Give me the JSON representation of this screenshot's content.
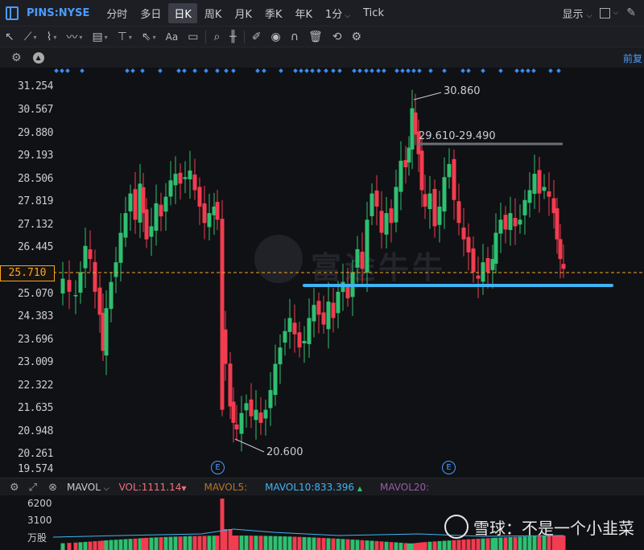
{
  "header": {
    "symbol": "PINS:NYSE",
    "timeframes": [
      {
        "label": "分时",
        "active": false,
        "dropdown": false
      },
      {
        "label": "多日",
        "active": false,
        "dropdown": false
      },
      {
        "label": "日K",
        "active": true,
        "dropdown": false
      },
      {
        "label": "周K",
        "active": false,
        "dropdown": false
      },
      {
        "label": "月K",
        "active": false,
        "dropdown": false
      },
      {
        "label": "季K",
        "active": false,
        "dropdown": false
      },
      {
        "label": "年K",
        "active": false,
        "dropdown": false
      },
      {
        "label": "1分",
        "active": false,
        "dropdown": true
      },
      {
        "label": "Tick",
        "active": false,
        "dropdown": false
      }
    ],
    "display_label": "显示"
  },
  "subbar": {
    "adjust_label": "前复"
  },
  "price_axis": {
    "labels": [
      "31.254",
      "30.567",
      "29.880",
      "29.193",
      "28.506",
      "27.819",
      "27.132",
      "26.445",
      "25.070",
      "24.383",
      "23.696",
      "23.009",
      "22.322",
      "21.635",
      "20.948",
      "20.261",
      "19.574"
    ],
    "current_price": "25.710"
  },
  "annotations": {
    "high": "30.860",
    "low": "20.600",
    "range": "29.610-29.490",
    "earnings_marker": "E"
  },
  "watermark": "富途牛牛",
  "volume_bar": {
    "indicator": "MAVOL",
    "vol": "VOL:1111.14",
    "mavol5": "MAVOL5:",
    "mavol10": "MAVOL10:833.396",
    "mavol20": "MAVOL20:"
  },
  "volume_axis": {
    "labels": [
      "6200",
      "3100",
      "万股"
    ]
  },
  "xueqiu_watermark": "雪球：不是一个小韭菜",
  "colors": {
    "up": "#2fbf71",
    "down": "#f23c4f",
    "accent": "#4b9bff",
    "current": "#f5a623",
    "support_line": "#3fb5f5"
  }
}
